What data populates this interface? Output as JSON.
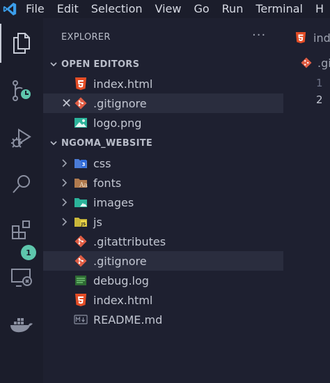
{
  "menu": {
    "items": [
      "File",
      "Edit",
      "Selection",
      "View",
      "Go",
      "Run",
      "Terminal",
      "H"
    ]
  },
  "activity": {
    "icons": [
      "explorer-icon",
      "source-control-icon",
      "run-debug-icon",
      "search-icon",
      "extensions-icon",
      "remote-explorer-icon",
      "docker-icon"
    ],
    "extensions_badge": "1"
  },
  "explorer": {
    "title": "EXPLORER",
    "more": "···",
    "open_editors": {
      "label": "OPEN EDITORS",
      "files": [
        {
          "name": "index.html",
          "icon": "html-icon"
        },
        {
          "name": ".gitignore",
          "icon": "git-icon",
          "selected": true
        },
        {
          "name": "logo.png",
          "icon": "image-icon"
        }
      ]
    },
    "project": {
      "label": "NGOMA_WEBSITE",
      "folders": [
        {
          "name": "css",
          "icon": "css-folder-icon"
        },
        {
          "name": "fonts",
          "icon": "fonts-folder-icon"
        },
        {
          "name": "images",
          "icon": "images-folder-icon"
        },
        {
          "name": "js",
          "icon": "js-folder-icon"
        }
      ],
      "files": [
        {
          "name": ".gitattributes",
          "icon": "git-icon"
        },
        {
          "name": ".gitignore",
          "icon": "git-icon",
          "selected": true
        },
        {
          "name": "debug.log",
          "icon": "log-icon"
        },
        {
          "name": "index.html",
          "icon": "html-icon"
        },
        {
          "name": "README.md",
          "icon": "markdown-icon"
        }
      ]
    }
  },
  "editor": {
    "tab_label": "inde",
    "breadcrumb": ".gi",
    "line_numbers": [
      "1",
      "2"
    ]
  },
  "colors": {
    "background": "#1e2030",
    "activity_bar": "#1b1d2b",
    "selection": "#2a2d3e",
    "html_orange": "#e44d26",
    "git_red": "#e05d44",
    "badge": "#5ec6ac"
  }
}
